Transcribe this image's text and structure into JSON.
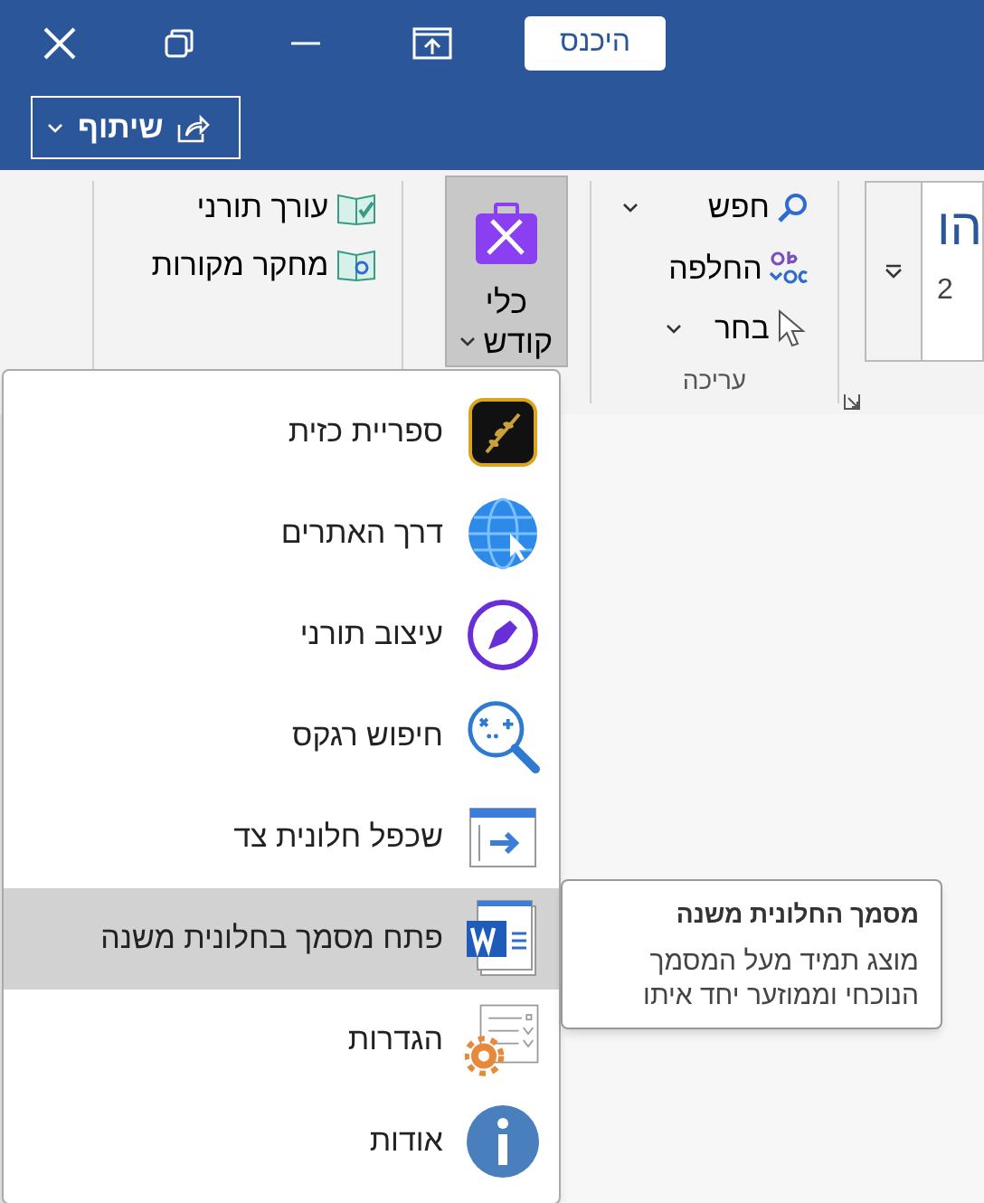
{
  "title_bar": {
    "sign_in": "היכנס"
  },
  "share_button": {
    "label": "שיתוף"
  },
  "ribbon": {
    "addin_group": {
      "items": [
        {
          "label": "עורך תורני"
        },
        {
          "label": "מחקר מקורות"
        }
      ]
    },
    "tools_button": {
      "label_1": "כלי",
      "label_2": "קודש",
      "selected": true
    },
    "editing_group": {
      "items": [
        {
          "label": "חפש",
          "kind": "dropdown"
        },
        {
          "label": "החלפה",
          "kind": "plain"
        },
        {
          "label": "בחר",
          "kind": "dropdown"
        }
      ],
      "label": "עריכה"
    },
    "styles_gallery": {
      "sample": "הו",
      "number": "2"
    }
  },
  "menu": {
    "items": [
      {
        "label": "ספריית כזית",
        "kind": "olive",
        "selected": false
      },
      {
        "label": "דרך האתרים",
        "kind": "globe",
        "selected": false
      },
      {
        "label": "עיצוב תורני",
        "kind": "pen",
        "selected": false
      },
      {
        "label": "חיפוש רגקס",
        "kind": "regex",
        "selected": false
      },
      {
        "label": "שכפל חלונית צד",
        "kind": "pane",
        "selected": false
      },
      {
        "label": "פתח מסמך בחלונית משנה",
        "kind": "word",
        "selected": true
      },
      {
        "label": "הגדרות",
        "kind": "settings",
        "selected": false
      },
      {
        "label": "אודות",
        "kind": "info",
        "selected": false
      }
    ]
  },
  "tooltip": {
    "title": "מסמך החלונית משנה",
    "body": "מוצג תמיד מעל המסמך הנוכחי וממוזער יחד איתו"
  }
}
